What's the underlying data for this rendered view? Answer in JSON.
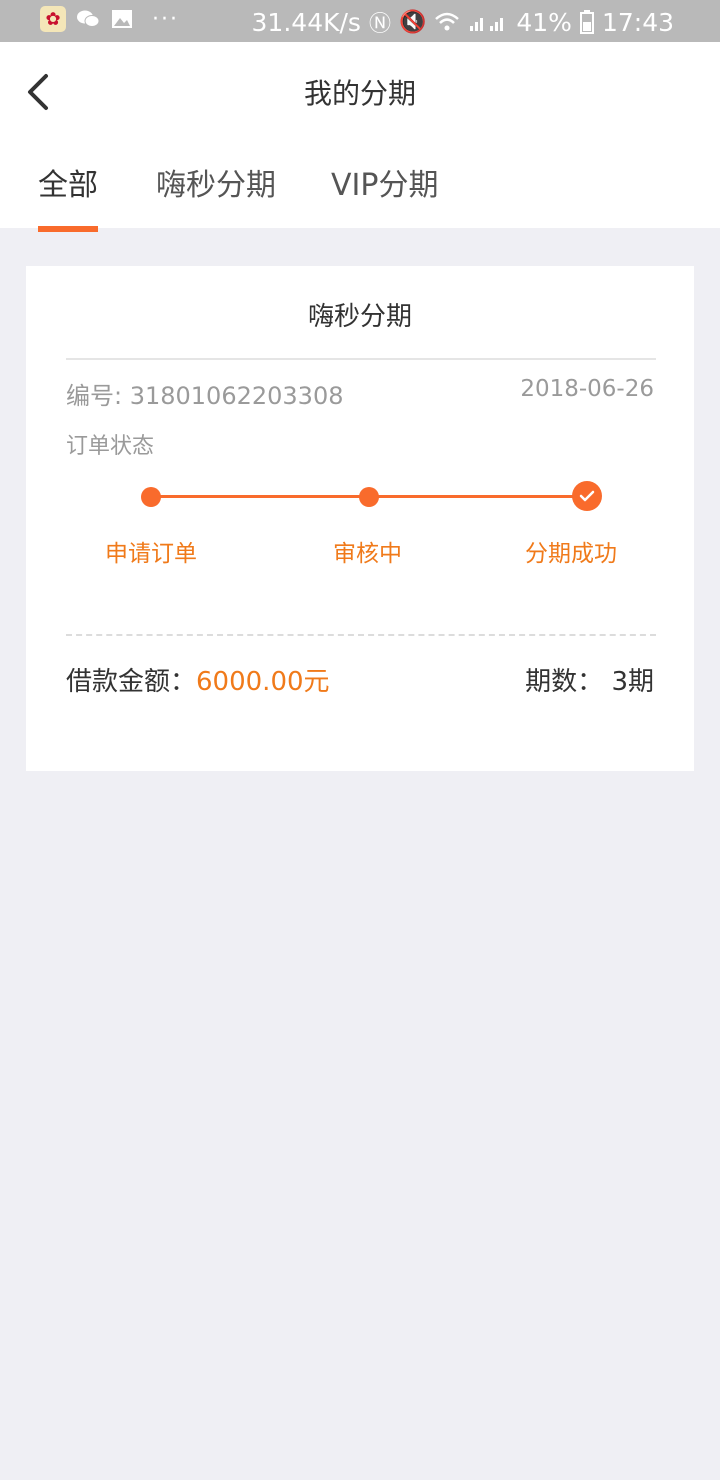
{
  "status_bar": {
    "network_speed": "31.44K/s",
    "battery": "41%",
    "time": "17:43",
    "dots": "···",
    "icons": [
      "app-icon",
      "wechat-icon",
      "gallery-icon",
      "nfc-icon",
      "mute-icon",
      "wifi-icon",
      "signal-icon",
      "battery-icon"
    ]
  },
  "header": {
    "title": "我的分期"
  },
  "tabs": [
    {
      "label": "全部",
      "active": true
    },
    {
      "label": "嗨秒分期",
      "active": false
    },
    {
      "label": "VIP分期",
      "active": false
    }
  ],
  "card": {
    "title": "嗨秒分期",
    "order_no": "编号: 31801062203308",
    "date": "2018-06-26",
    "status_label": "订单状态",
    "steps": [
      "申请订单",
      "审核中",
      "分期成功"
    ],
    "amount_label": "借款金额：",
    "amount_value": "6000.00元",
    "periods_label": "期数：",
    "periods_value": "3期"
  },
  "colors": {
    "accent": "#f96b2c",
    "accent_text": "#f07a1a",
    "background": "#efeff4"
  }
}
